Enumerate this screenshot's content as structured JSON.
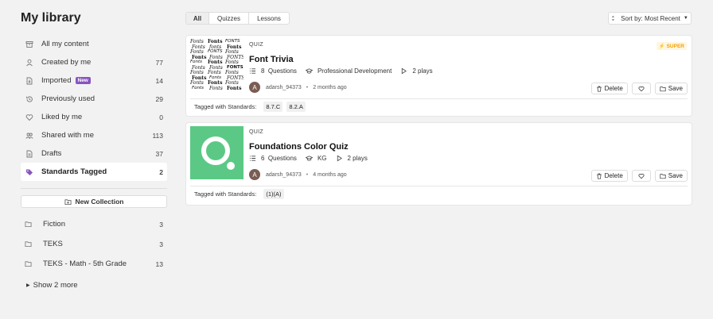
{
  "library": {
    "title": "My library",
    "nav": [
      {
        "label": "All my content",
        "count": "",
        "icon": "archive-icon"
      },
      {
        "label": "Created by me",
        "count": "77",
        "icon": "user-icon"
      },
      {
        "label": "Imported",
        "count": "14",
        "icon": "import-icon",
        "badge": "New"
      },
      {
        "label": "Previously used",
        "count": "29",
        "icon": "history-icon"
      },
      {
        "label": "Liked by me",
        "count": "0",
        "icon": "heart-icon"
      },
      {
        "label": "Shared with me",
        "count": "113",
        "icon": "users-icon"
      },
      {
        "label": "Drafts",
        "count": "37",
        "icon": "document-icon"
      },
      {
        "label": "Standards Tagged",
        "count": "2",
        "icon": "tags-icon",
        "active": true
      }
    ],
    "new_collection_label": "New Collection",
    "folders": [
      {
        "label": "Fiction",
        "count": "3"
      },
      {
        "label": "TEKS",
        "count": "3"
      },
      {
        "label": "TEKS - Math - 5th Grade",
        "count": "13"
      }
    ],
    "show_more_label": "Show 2 more"
  },
  "filters": {
    "tabs": [
      "All",
      "Quizzes",
      "Lessons"
    ],
    "active_tab": "All",
    "sort_label": "Sort by: Most Recent"
  },
  "colors": {
    "accent_purple": "#8854c0",
    "super_gold": "#f5a100",
    "quiz_green": "#5bc985"
  },
  "cards": [
    {
      "type": "QUIZ",
      "title": "Font Trivia",
      "questions": "8",
      "questions_label": "Questions",
      "grade": "Professional Development",
      "plays": "2 plays",
      "author": "adarsh_94373",
      "author_initial": "A",
      "time": "2 months ago",
      "super_label": "SUPER",
      "tagged_label": "Tagged with Standards:",
      "standards": [
        "8.7.C",
        "8.2.A"
      ],
      "delete_label": "Delete",
      "save_label": "Save",
      "thumb_words": [
        "Fonts",
        "Fonts",
        "FONTS",
        "Fonts",
        "fonts",
        "Fonts",
        "Fonts",
        "FONTS",
        "Fonts",
        "Fonts",
        "Fonts",
        "FONTS",
        "Fonts",
        "Fonts",
        "Fonts",
        "Fonts",
        "Fonts",
        "FONTS",
        "Fonts",
        "Fonts",
        "Fonts",
        "Fonts",
        "Fonts",
        "FONTS",
        "Fonts",
        "Fonts",
        "Fonts",
        "Fonts",
        "Fonts",
        "Fonts"
      ]
    },
    {
      "type": "QUIZ",
      "title": "Foundations Color Quiz",
      "questions": "6",
      "questions_label": "Questions",
      "grade": "KG",
      "plays": "2 plays",
      "author": "adarsh_94373",
      "author_initial": "A",
      "time": "4 months ago",
      "tagged_label": "Tagged with Standards:",
      "standards": [
        "(1)(A)"
      ],
      "delete_label": "Delete",
      "save_label": "Save"
    }
  ]
}
